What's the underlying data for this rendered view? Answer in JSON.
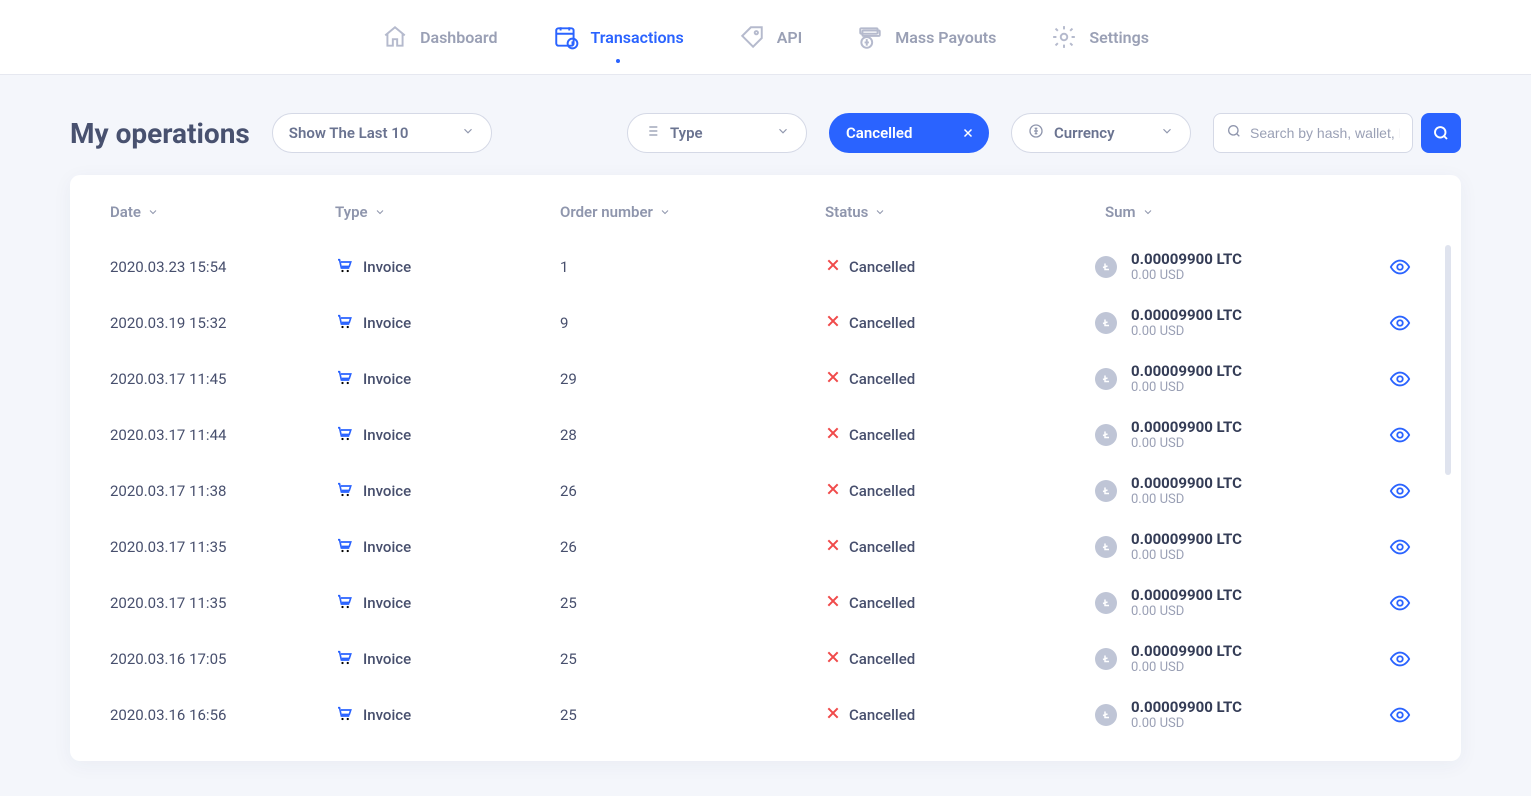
{
  "nav": {
    "items": [
      {
        "label": "Dashboard",
        "active": false
      },
      {
        "label": "Transactions",
        "active": true
      },
      {
        "label": "API",
        "active": false
      },
      {
        "label": "Mass Payouts",
        "active": false
      },
      {
        "label": "Settings",
        "active": false
      }
    ]
  },
  "page": {
    "title": "My operations"
  },
  "filters": {
    "show_last_label": "Show The Last 10",
    "type_label": "Type",
    "status_label": "Cancelled",
    "currency_label": "Currency",
    "search_placeholder": "Search by hash, wallet, ID"
  },
  "columns": {
    "date": "Date",
    "type": "Type",
    "order": "Order number",
    "status": "Status",
    "sum": "Sum"
  },
  "rows": [
    {
      "date": "2020.03.23 15:54",
      "type": "Invoice",
      "order": "1",
      "status": "Cancelled",
      "crypto": "0.00009900 LTC",
      "fiat": "0.00 USD"
    },
    {
      "date": "2020.03.19 15:32",
      "type": "Invoice",
      "order": "9",
      "status": "Cancelled",
      "crypto": "0.00009900 LTC",
      "fiat": "0.00 USD"
    },
    {
      "date": "2020.03.17 11:45",
      "type": "Invoice",
      "order": "29",
      "status": "Cancelled",
      "crypto": "0.00009900 LTC",
      "fiat": "0.00 USD"
    },
    {
      "date": "2020.03.17 11:44",
      "type": "Invoice",
      "order": "28",
      "status": "Cancelled",
      "crypto": "0.00009900 LTC",
      "fiat": "0.00 USD"
    },
    {
      "date": "2020.03.17 11:38",
      "type": "Invoice",
      "order": "26",
      "status": "Cancelled",
      "crypto": "0.00009900 LTC",
      "fiat": "0.00 USD"
    },
    {
      "date": "2020.03.17 11:35",
      "type": "Invoice",
      "order": "26",
      "status": "Cancelled",
      "crypto": "0.00009900 LTC",
      "fiat": "0.00 USD"
    },
    {
      "date": "2020.03.17 11:35",
      "type": "Invoice",
      "order": "25",
      "status": "Cancelled",
      "crypto": "0.00009900 LTC",
      "fiat": "0.00 USD"
    },
    {
      "date": "2020.03.16 17:05",
      "type": "Invoice",
      "order": "25",
      "status": "Cancelled",
      "crypto": "0.00009900 LTC",
      "fiat": "0.00 USD"
    },
    {
      "date": "2020.03.16 16:56",
      "type": "Invoice",
      "order": "25",
      "status": "Cancelled",
      "crypto": "0.00009900 LTC",
      "fiat": "0.00 USD"
    }
  ]
}
